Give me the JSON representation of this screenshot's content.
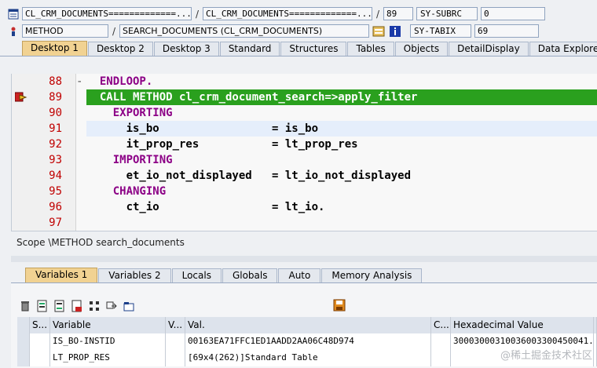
{
  "header": {
    "row1": {
      "icon": "program-icon",
      "field1": "CL_CRM_DOCUMENTS=============...",
      "sep1": "/",
      "field2": "CL_CRM_DOCUMENTS=============...",
      "sep2": "/",
      "line": "89",
      "sysvar": "SY-SUBRC",
      "sysval": "0"
    },
    "row2": {
      "icon": "method-icon",
      "field1": "METHOD",
      "sep1": "/",
      "field2": "SEARCH_DOCUMENTS (CL_CRM_DOCUMENTS)",
      "sysvar": "SY-TABIX",
      "sysval": "69"
    }
  },
  "desktop_tabs": [
    "Desktop 1",
    "Desktop 2",
    "Desktop 3",
    "Standard",
    "Structures",
    "Tables",
    "Objects",
    "DetailDisplay",
    "Data Explorer"
  ],
  "desktop_active": "Desktop 1",
  "code": {
    "lines": [
      {
        "no": "88",
        "fold": "-",
        "text": "  ENDLOOP."
      },
      {
        "no": "89",
        "fold": "",
        "text": "  CALL METHOD cl_crm_document_search=>apply_filter"
      },
      {
        "no": "90",
        "fold": "",
        "text": "    EXPORTING"
      },
      {
        "no": "91",
        "fold": "",
        "text": "      is_bo                 = is_bo"
      },
      {
        "no": "92",
        "fold": "",
        "text": "      it_prop_res           = lt_prop_res"
      },
      {
        "no": "93",
        "fold": "",
        "text": "    IMPORTING"
      },
      {
        "no": "94",
        "fold": "",
        "text": "      et_io_not_displayed   = lt_io_not_displayed"
      },
      {
        "no": "95",
        "fold": "",
        "text": "    CHANGING"
      },
      {
        "no": "96",
        "fold": "",
        "text": "      ct_io                 = lt_io."
      },
      {
        "no": "97",
        "fold": "",
        "text": ""
      }
    ],
    "current_line": "89",
    "cursor_line": "91"
  },
  "scope": "Scope \\METHOD search_documents",
  "var_tabs": [
    "Variables 1",
    "Variables 2",
    "Locals",
    "Globals",
    "Auto",
    "Memory Analysis"
  ],
  "var_active": "Variables 1",
  "table": {
    "headers": [
      "",
      "S...",
      "Variable",
      "V...",
      "Val.",
      "C...",
      "Hexadecimal Value",
      ""
    ],
    "rows": [
      {
        "variable": "IS_BO-INSTID",
        "value": "00163EA71FFC1ED1AADD2AA06C48D974",
        "hex": "30003000310036003300450041..."
      },
      {
        "variable": "LT_PROP_RES",
        "value": "[69x4(262)]Standard Table",
        "hex": ""
      }
    ]
  },
  "watermark": "@稀土掘金技术社区"
}
